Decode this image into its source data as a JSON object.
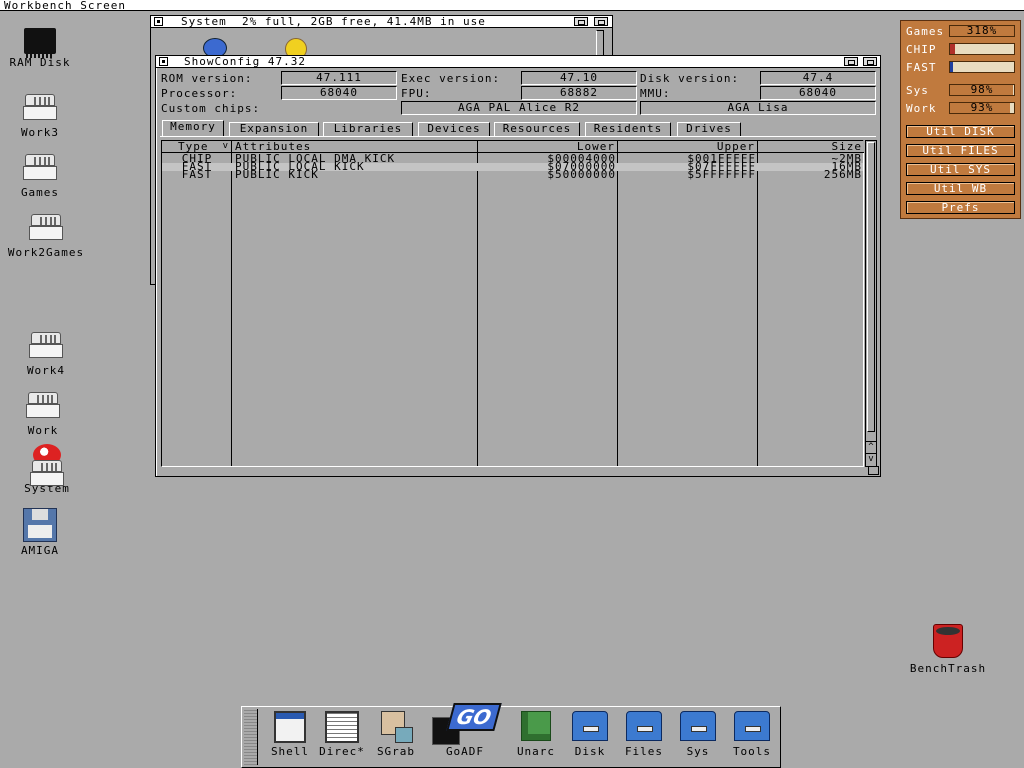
{
  "screen": {
    "title": "Workbench Screen"
  },
  "desktop_icons": [
    {
      "id": "ram-disk",
      "label": "RAM Disk",
      "icon": "chip-icon"
    },
    {
      "id": "work3",
      "label": "Work3",
      "icon": "harddisk-icon"
    },
    {
      "id": "games",
      "label": "Games",
      "icon": "harddisk-icon"
    },
    {
      "id": "work2games",
      "label": "Work2Games",
      "icon": "harddisk-icon"
    },
    {
      "id": "work4",
      "label": "Work4",
      "icon": "harddisk-icon"
    },
    {
      "id": "work",
      "label": "Work",
      "icon": "harddisk-icon"
    },
    {
      "id": "system",
      "label": "System",
      "icon": "boing-ball-icon"
    },
    {
      "id": "amiga",
      "label": "AMIGA",
      "icon": "floppy-icon"
    },
    {
      "id": "benchtrash",
      "label": "BenchTrash",
      "icon": "trash-icon"
    }
  ],
  "system_window": {
    "title": "System  2% full, 2GB free, 41.4MB in use"
  },
  "showconfig": {
    "title": "ShowConfig 47.32",
    "rom_label": "ROM version:",
    "rom_value": "47.111",
    "exec_label": "Exec version:",
    "exec_value": "47.10",
    "disk_label": "Disk version:",
    "disk_value": "47.4",
    "cpu_label": "Processor:",
    "cpu_value": "68040",
    "fpu_label": "FPU:",
    "fpu_value": "68882",
    "mmu_label": "MMU:",
    "mmu_value": "68040",
    "chips_label": "Custom chips:",
    "chip1": "AGA PAL Alice R2",
    "chip2": "AGA Lisa",
    "tabs": [
      "Memory",
      "Expansion",
      "Libraries",
      "Devices",
      "Resources",
      "Residents",
      "Drives"
    ],
    "active_tab": "Memory",
    "columns": {
      "type": "Type",
      "type_sort": "v",
      "attributes": "Attributes",
      "lower": "Lower",
      "upper": "Upper",
      "size": "Size"
    },
    "rows": [
      {
        "type": "CHIP",
        "attributes": "PUBLIC LOCAL DMA KICK",
        "lower": "$00004000",
        "upper": "$001FFFFF",
        "size": "~2MB"
      },
      {
        "type": "FAST",
        "attributes": "PUBLIC LOCAL KICK",
        "lower": "$07000000",
        "upper": "$07FFFFFF",
        "size": "16MB"
      },
      {
        "type": "FAST",
        "attributes": "PUBLIC KICK",
        "lower": "$50000000",
        "upper": "$5FFFFFFF",
        "size": "256MB"
      }
    ],
    "scroll_up": "^",
    "scroll_down": "v"
  },
  "side_panel": {
    "gauges": [
      {
        "label": "Games",
        "text": "318%",
        "fill": 1.0,
        "color": "#c07a3e"
      },
      {
        "label": "CHIP",
        "text": "",
        "fill": 0.08,
        "color": "#b0302a"
      },
      {
        "label": "FAST",
        "text": "",
        "fill": 0.04,
        "color": "#2040a0"
      },
      {
        "label": "Sys",
        "text": "98%",
        "fill": 0.98,
        "color": "#c07a3e"
      },
      {
        "label": "Work",
        "text": "93%",
        "fill": 0.93,
        "color": "#c07a3e"
      }
    ],
    "buttons": [
      "Util DISK",
      "Util FILES",
      "Util SYS",
      "Util WB",
      "Prefs"
    ]
  },
  "dock": {
    "items": [
      "Shell",
      "Direc*",
      "SGrab",
      "GoADF",
      "Unarc",
      "Disk",
      "Files",
      "Sys",
      "Tools"
    ]
  },
  "colors": {
    "background": "#aaaaaa",
    "panel": "#c07a3e",
    "drawer": "#3c7ad0"
  }
}
